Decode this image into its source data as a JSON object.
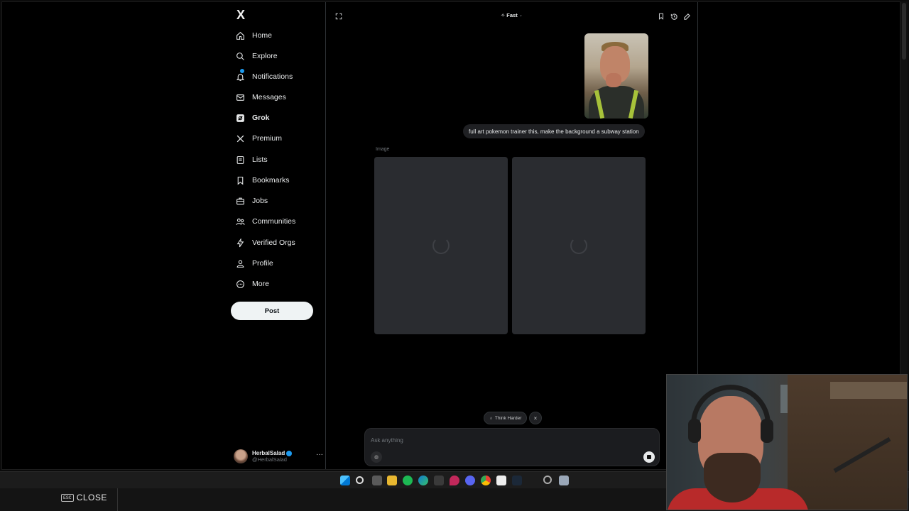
{
  "sidebar": {
    "logo": "X",
    "items": [
      {
        "label": "Home",
        "icon": "home-icon"
      },
      {
        "label": "Explore",
        "icon": "search-icon"
      },
      {
        "label": "Notifications",
        "icon": "bell-icon"
      },
      {
        "label": "Messages",
        "icon": "mail-icon"
      },
      {
        "label": "Grok",
        "icon": "grok-icon"
      },
      {
        "label": "Premium",
        "icon": "x-logo-icon"
      },
      {
        "label": "Lists",
        "icon": "list-icon"
      },
      {
        "label": "Bookmarks",
        "icon": "bookmark-icon"
      },
      {
        "label": "Jobs",
        "icon": "briefcase-icon"
      },
      {
        "label": "Communities",
        "icon": "people-icon"
      },
      {
        "label": "Verified Orgs",
        "icon": "lightning-icon"
      },
      {
        "label": "Profile",
        "icon": "person-icon"
      },
      {
        "label": "More",
        "icon": "more-circle-icon"
      }
    ],
    "post_label": "Post",
    "account": {
      "name": "HerbalSalad",
      "handle": "@HerbalSalad",
      "more": "···"
    }
  },
  "main": {
    "mode": "Fast",
    "user_message": "full art pokemon trainer this, make the background a subway station",
    "image_label": "Image",
    "think_harder": "Think Harder",
    "close_glyph": "×",
    "composer_placeholder": "Ask anything"
  },
  "overlay": {
    "esc_key": "ESC",
    "close_label": "CLOSE"
  },
  "colors": {
    "accent": "#1d9bf0",
    "background": "#000000",
    "card": "#2a2c30"
  }
}
